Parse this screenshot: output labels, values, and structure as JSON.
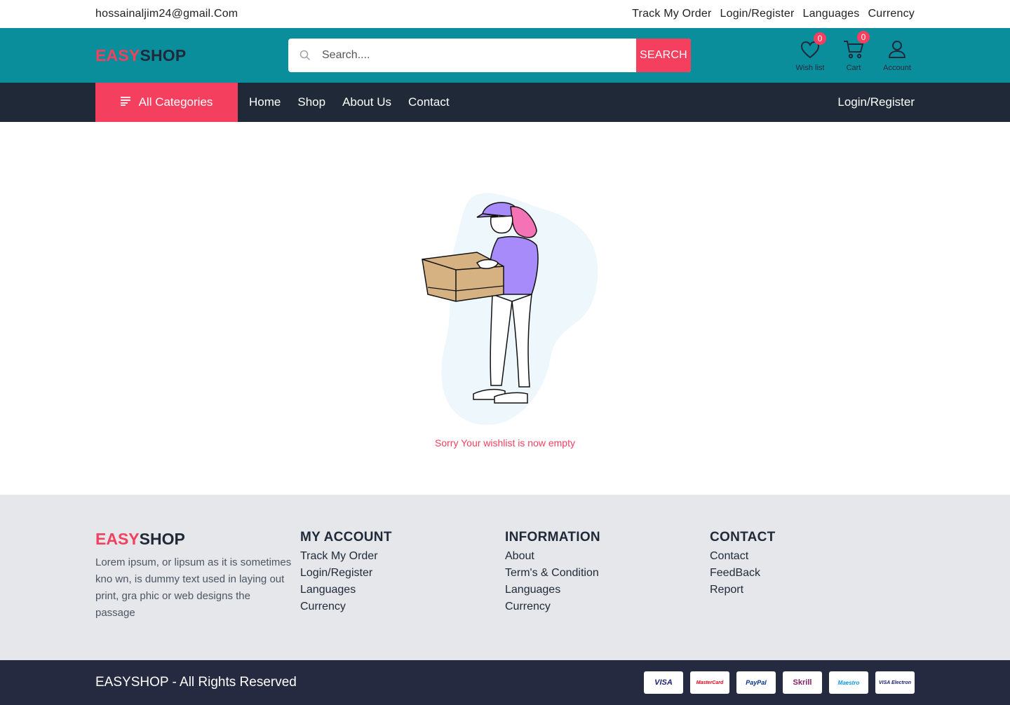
{
  "topbar": {
    "email": "hossainaljim24@gmail.Com",
    "links": [
      "Track My Order",
      "Login/Register",
      "Languages",
      "Currency"
    ]
  },
  "header": {
    "logo_part1": "EASY",
    "logo_part2": "SHOP",
    "search_placeholder": "Search....",
    "search_button": "SEARCH",
    "wishlist_label": "Wish list",
    "wishlist_count": "0",
    "cart_label": "Cart",
    "cart_count": "0",
    "account_label": "Account",
    "icons": [
      "heart-icon",
      "cart-icon",
      "user-icon",
      "search-icon"
    ]
  },
  "nav": {
    "all_categories": "All Categories",
    "links": [
      "Home",
      "Shop",
      "About Us",
      "Contact"
    ],
    "login": "Login/Register"
  },
  "main": {
    "empty_message": "Sorry Your wishlist is now empty"
  },
  "footer": {
    "logo_part1": "EASY",
    "logo_part2": "SHOP",
    "description": "Lorem ipsum, or lipsum as it is sometimes kno wn, is dummy text used in laying out print, gra phic or web designs the passage",
    "columns": [
      {
        "heading": "MY ACCOUNT",
        "links": [
          "Track My Order",
          "Login/Register",
          "Languages",
          "Currency"
        ]
      },
      {
        "heading": "INFORMATION",
        "links": [
          "About",
          "Term's & Condition",
          "Languages",
          "Currency"
        ]
      },
      {
        "heading": "CONTACT",
        "links": [
          "Contact",
          "FeedBack",
          "Report"
        ]
      }
    ]
  },
  "bottom": {
    "copyright": "EASYSHOP - All Rights Reserved",
    "payments": [
      "VISA",
      "MasterCard",
      "PayPal",
      "Skrill",
      "Maestro",
      "VISA Electron"
    ]
  },
  "colors": {
    "teal": "#0b8e9c",
    "accent": "#f43f5e",
    "nav_dark": "#1f2937",
    "footer_bg": "#e5e7eb",
    "bottom_bg": "#262a40"
  }
}
